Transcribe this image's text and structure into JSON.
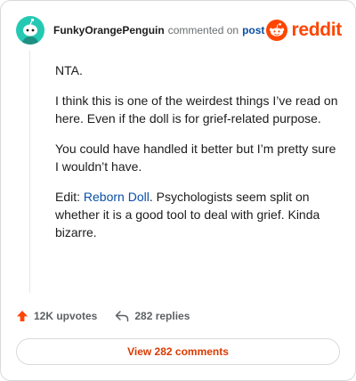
{
  "header": {
    "username": "FunkyOrangePenguin",
    "action_text": "commented on",
    "post_link": "post",
    "brand": "reddit",
    "avatar_icon": "snoo-avatar-icon",
    "logo_icon": "reddit-alien-icon"
  },
  "comment": {
    "paragraphs": [
      "NTA.",
      "I think this is one of the weirdest things I’ve read on here. Even if the doll is for grief-related purpose.",
      "You could have handled it better but I’m pretty sure I wouldn’t have."
    ],
    "edit_prefix": "Edit: ",
    "edit_link": "Reborn Doll",
    "edit_suffix": ". Psychologists seem split on whether it is a good tool to deal with grief. Kinda bizarre."
  },
  "footer": {
    "upvotes": "12K upvotes",
    "replies": "282 replies",
    "upvote_icon": "upvote-arrow-icon",
    "reply_icon": "reply-arrow-icon"
  },
  "view_button": "View 282 comments",
  "colors": {
    "avatar_bg": "#25c9b3",
    "brand": "#ff4500",
    "link": "#0a4fa6",
    "button_text": "#d93a00",
    "border": "#d8dadb"
  }
}
